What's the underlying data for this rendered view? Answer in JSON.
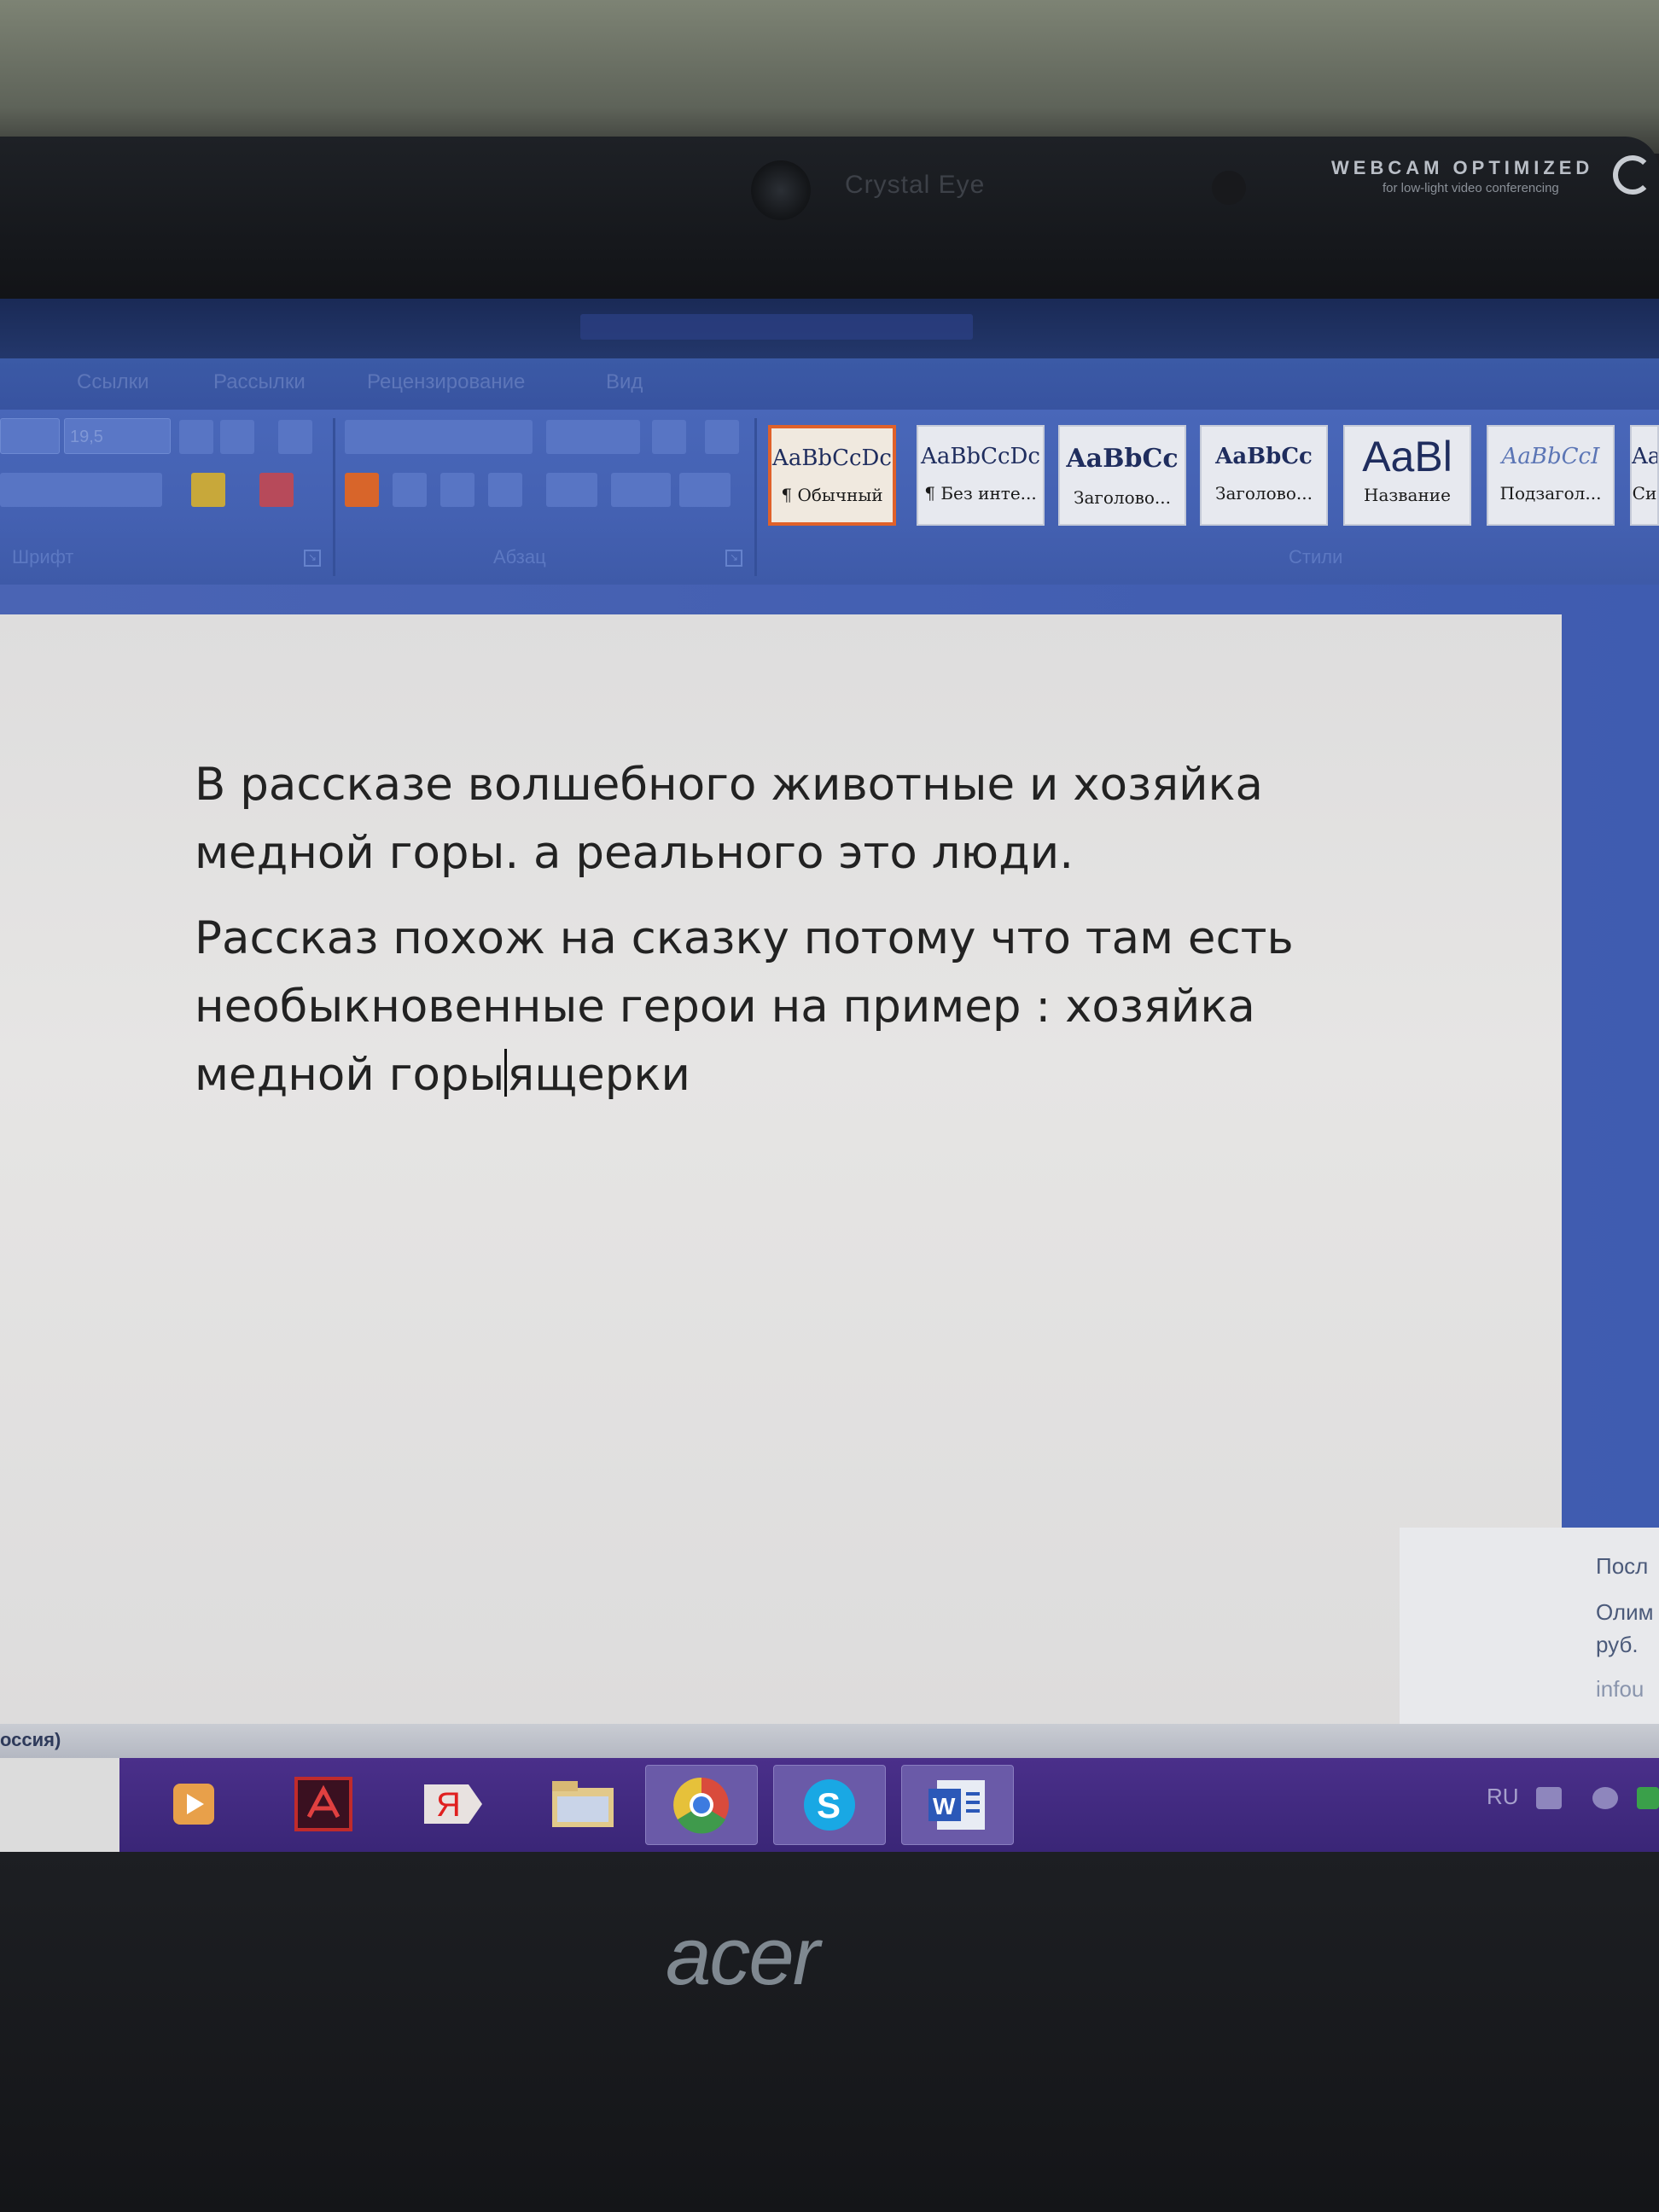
{
  "camera": {
    "label": "Crystal Eye",
    "badge_title": "WEBCAM OPTIMIZED",
    "badge_sub": "for low-light video conferencing"
  },
  "ribbon": {
    "tabs": [
      "Ссылки",
      "Рассылки",
      "Рецензирование",
      "Вид"
    ],
    "font_size": "19,5",
    "groups": {
      "font": "Шрифт",
      "paragraph": "Абзац",
      "styles": "Стили"
    },
    "styles": [
      {
        "sample": "AaBbCcDc",
        "name": "¶ Обычный",
        "selected": true
      },
      {
        "sample": "AaBbCcDc",
        "name": "¶ Без инте...",
        "selected": false
      },
      {
        "sample": "AaBbCc",
        "name": "Заголово...",
        "selected": false
      },
      {
        "sample": "AaBbCc",
        "name": "Заголово...",
        "selected": false
      },
      {
        "sample": "AaBl",
        "name": "Название",
        "selected": false
      },
      {
        "sample": "AaBbCcI",
        "name": "Подзагол...",
        "selected": false
      },
      {
        "sample": "Aa",
        "name": "Си",
        "selected": false
      }
    ]
  },
  "document": {
    "paragraph1_line1": "В рассказе волшебного животные и хозяйка",
    "paragraph1_line2": "медной горы. а реального это люди.",
    "paragraph2_line1": "Рассказ похож на сказку потому что там есть",
    "paragraph2_line2": "необыкновенные герои на пример : хозяйка",
    "paragraph2_line3_before_caret": "медной горы",
    "paragraph2_line3_after_caret": "ящерки"
  },
  "notification": {
    "line1": "Посл",
    "line2": "Олим",
    "line3": "руб.",
    "line4": "infou"
  },
  "statusbar": {
    "language": "оссия)"
  },
  "taskbar": {
    "apps": [
      "media-player",
      "adobe-reader",
      "yandex-browser",
      "file-explorer",
      "chrome",
      "skype",
      "word"
    ],
    "language": "RU"
  },
  "laptop": {
    "brand": "acer"
  },
  "colors": {
    "ribbon": "#4967b9",
    "taskbar": "#3a2677",
    "selected_style_border": "#e0612a"
  }
}
